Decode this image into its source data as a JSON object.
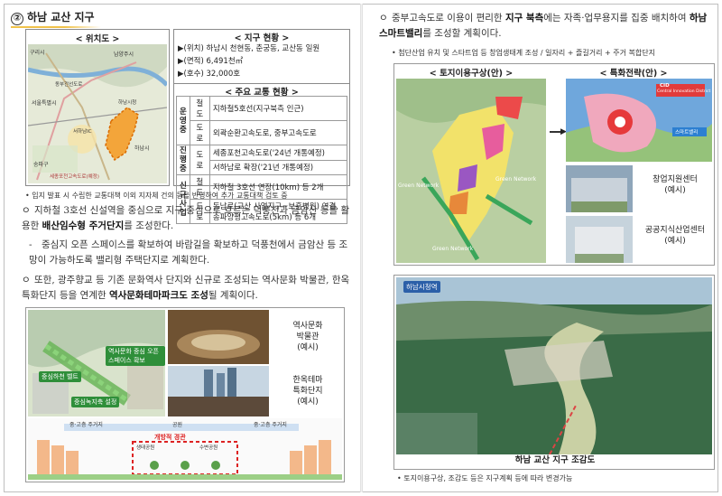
{
  "left": {
    "section_number": "②",
    "section_title": "하남 교산 지구",
    "location_map": {
      "title": "< 위치도 >",
      "labels": [
        "구리시",
        "남양주시",
        "하남시",
        "서울특별시",
        "송파구",
        "세종포천고속도로(예정)",
        "동부간선도로",
        "서하남IC",
        "하남시청"
      ]
    },
    "status": {
      "title": "< 지구 현황 >",
      "rows": [
        "▶(위치) 하남시 천현동, 춘궁동, 교산동 일원",
        "▶(면적) 6,491천㎡",
        "▶(호수) 32,000호"
      ]
    },
    "traffic": {
      "title": "< 주요 교통 현황 >",
      "groups": [
        {
          "label": "운영중",
          "items": [
            {
              "type": "철도",
              "text": "지하철5호선(지구북측 인근)"
            },
            {
              "type": "도로",
              "text": "외곽순환고속도로, 중부고속도로"
            }
          ]
        },
        {
          "label": "진행중",
          "items": [
            {
              "type": "도로",
              "text": "세종포천고속도로('24년 개통예정)"
            },
            {
              "type": "",
              "text": "서하남로 확장('21년 개통예정)"
            }
          ]
        },
        {
          "label": "신규사업",
          "items": [
            {
              "type": "철도",
              "text": "지하철 3호선 연장(10km) 등 2개"
            },
            {
              "type": "도로",
              "text": "동남로(교산 사업지구~보훈병원) 연결, 송파양평고속도로(5km) 등 6개"
            }
          ]
        }
      ]
    },
    "footnote": "• 입지 발표 시 수립한 교통대책 이외 지자체 건의 등을 반영하여 추가 교통대책 검토 중",
    "paragraphs": [
      {
        "marker": "ㅇ",
        "text_plain": "지하철 3호선 신설역을 중심으로 지구 중심으로 흐르는 덕풍천과 금암산 등을 활용한 ",
        "emph": "배산임수형 주거단지",
        "tail": "를 조성한다."
      },
      {
        "marker": "-",
        "text_plain": "중심지 오픈 스페이스를 확보하여 바람길을 확보하고 덕풍천에서 금암산 등 조망이 가능하도록 밸리형 주택단지로 계획한다.",
        "emph": "",
        "tail": ""
      },
      {
        "marker": "ㅇ",
        "text_plain": "또한, 광주향교 등 기존 문화역사 단지와 신규로 조성되는 역사문화 박물관, 한옥 특화단지 등을 연계한 ",
        "emph": "역사문화테마파크도 조성",
        "tail": "될 계획이다."
      }
    ],
    "bottom_left": {
      "labels": [
        "역사문화 중심 오픈스페이스 확보",
        "중심하천 벨트",
        "중심녹지축 설정"
      ]
    },
    "side_images": [
      {
        "caption": "역사문화\n박물관\n(예시)"
      },
      {
        "caption": "한옥테마\n특화단지\n(예시)"
      }
    ],
    "section_diagram": {
      "labels": [
        "중·고층 주거지",
        "공원",
        "중·고층 주거지",
        "개방적 경관",
        "생태공원",
        "수변공원"
      ]
    }
  },
  "right": {
    "paragraph": {
      "marker": "ㅇ",
      "text_plain": "중부고속도로 이용이 편리한 ",
      "emph1": "지구 북측",
      "mid": "에는 자족·업무용지를 집중 배치하여 ",
      "emph2": "하남 스마트밸리",
      "tail": "를 조성할 계획이다."
    },
    "subnote": "• 첨단산업 유치 및 스타트업 등 창업생태계 조성 / 일자리 + 즐길거리 + 주거 복합단지",
    "land_use": {
      "title": "< 토지이용구상(안) >",
      "labels": [
        "Green Network",
        "Green Network",
        "Green Network"
      ]
    },
    "strategy": {
      "title": "< 특화전략(안) >",
      "labels": [
        "CID",
        "Central Innovation District",
        "스마트밸리"
      ]
    },
    "examples": [
      {
        "caption": "창업지원센터\n(예시)"
      },
      {
        "caption": "공공지식산업센터\n(예시)"
      }
    ],
    "aerial": {
      "tag": "하남시청역",
      "caption": "하남 교산 지구 조감도"
    },
    "footnote": "• 토지이용구상, 조감도 등은 지구계획 등에 따라 변경가능"
  }
}
